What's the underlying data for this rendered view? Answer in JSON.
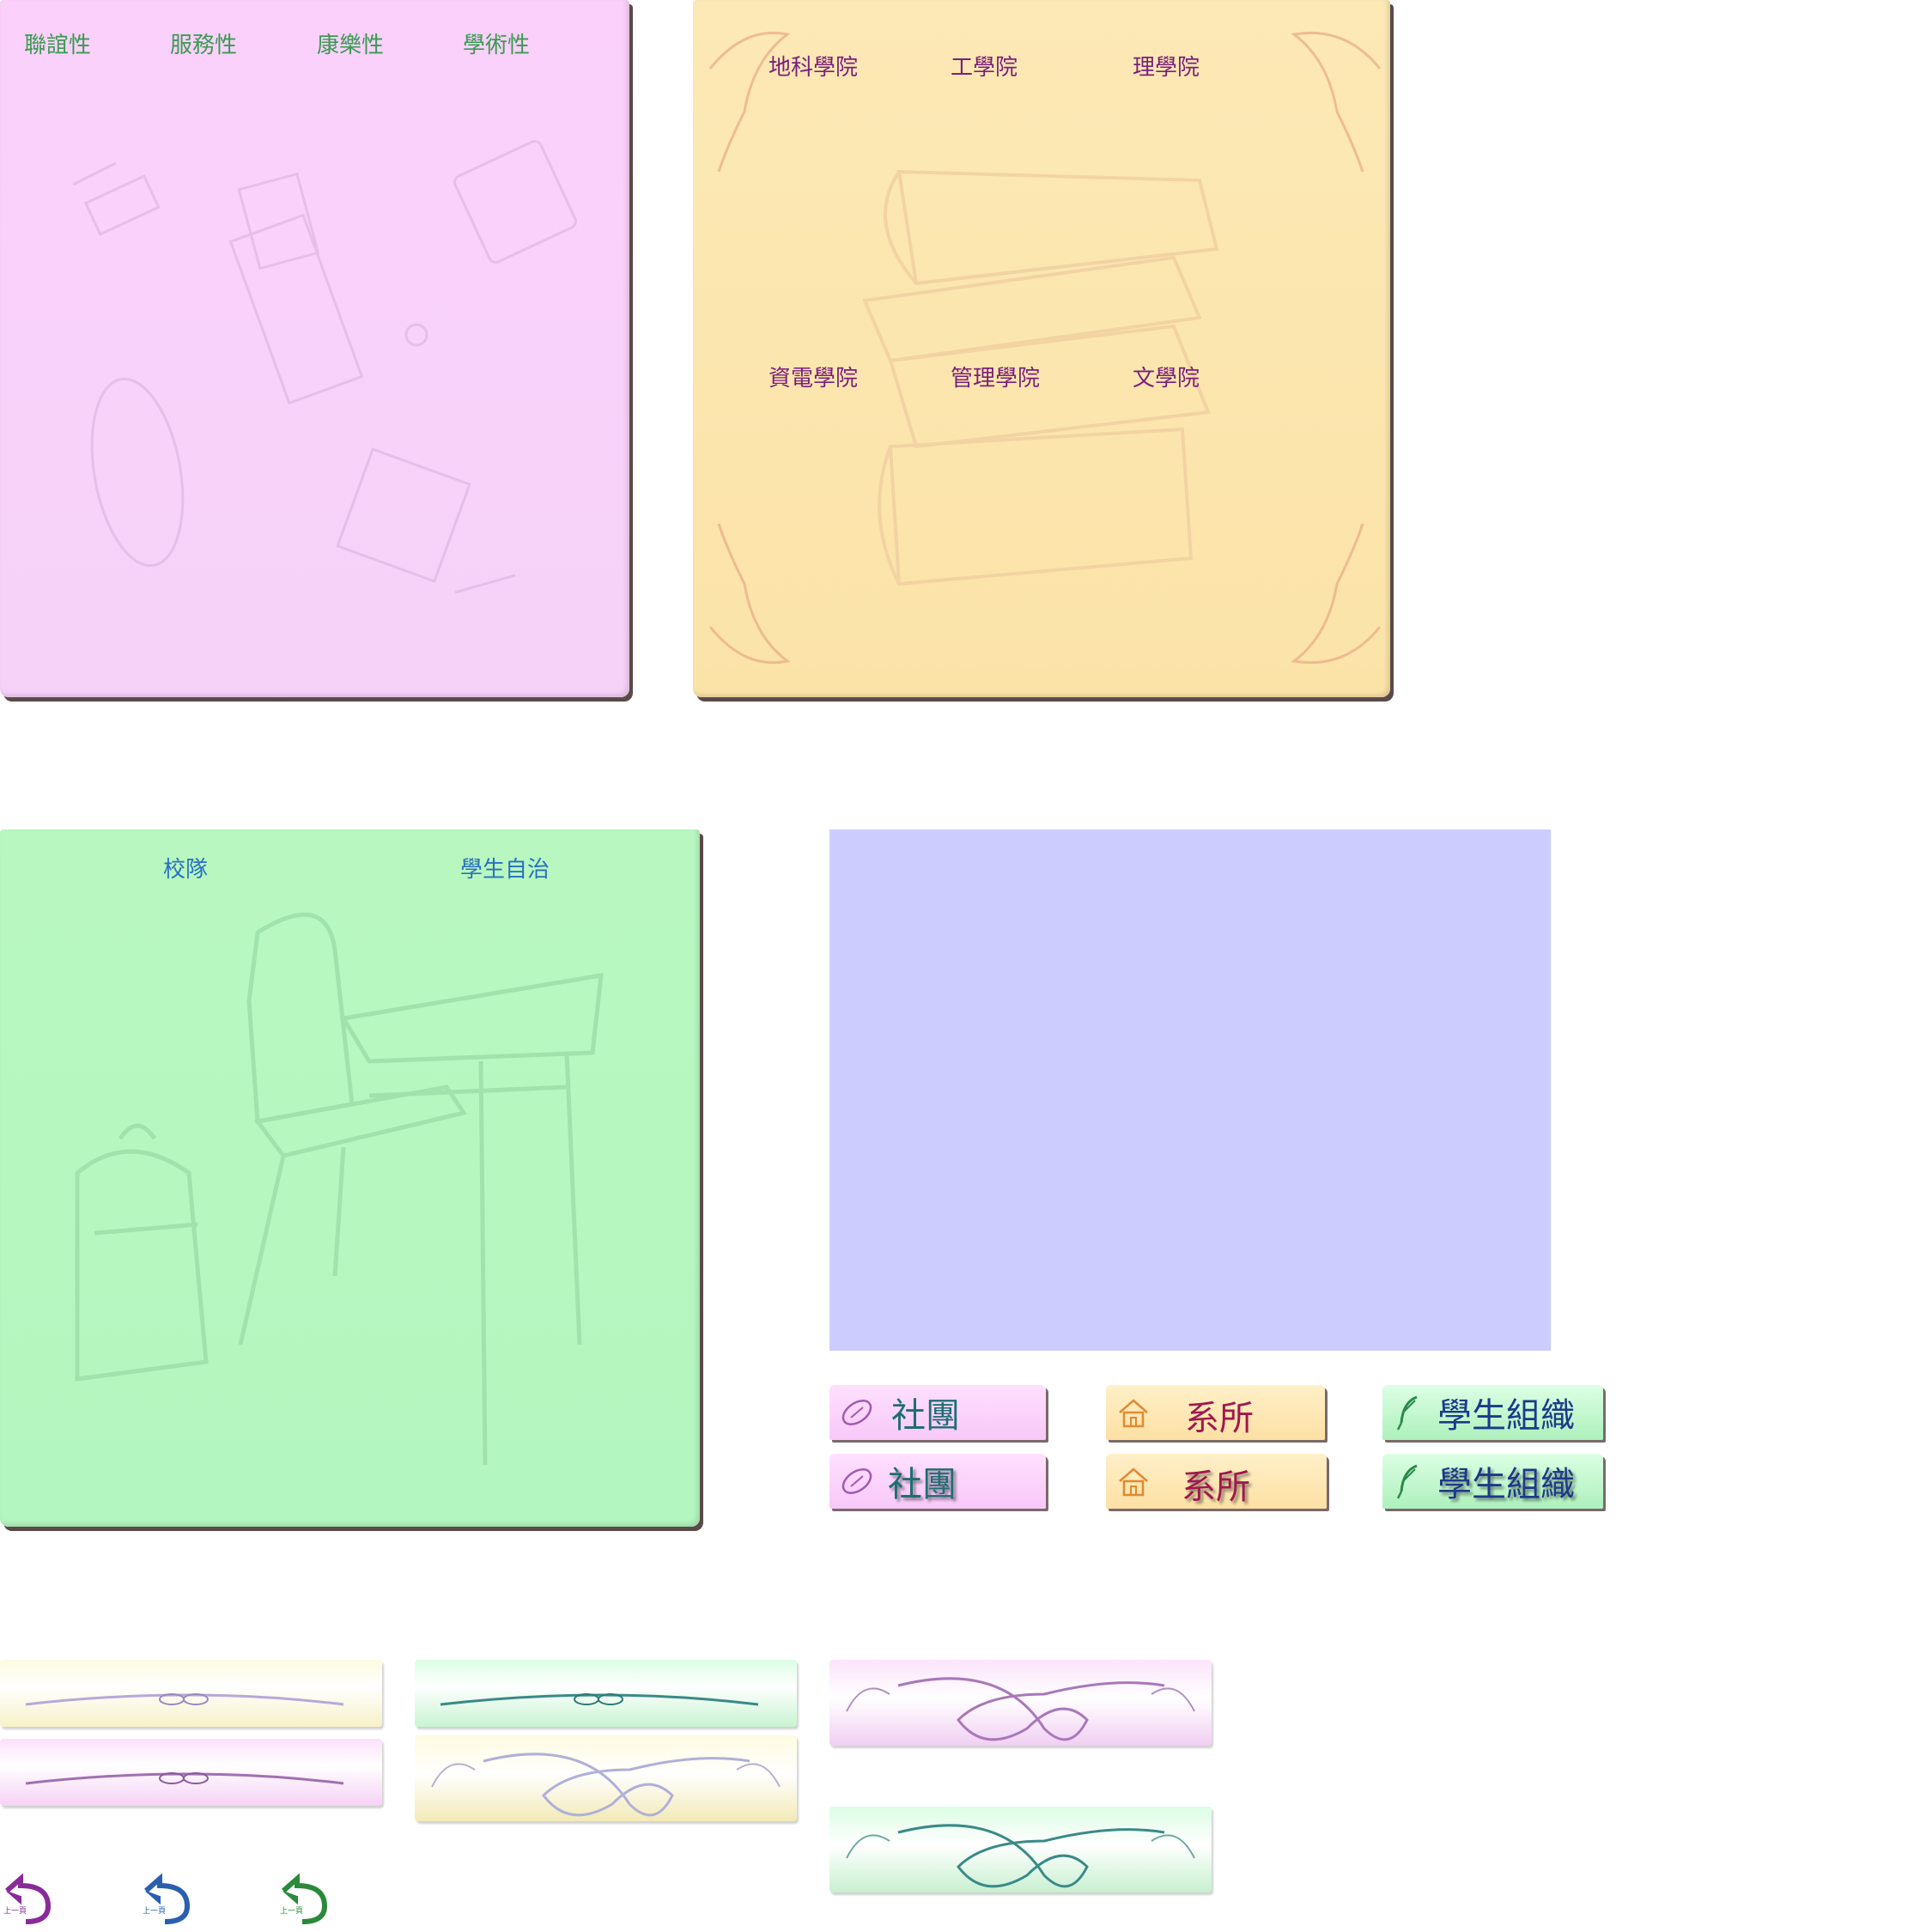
{
  "pink_panel": {
    "tabs": [
      "聯誼性",
      "服務性",
      "康樂性",
      "學術性"
    ],
    "color": "#fbd1fb"
  },
  "yellow_panel": {
    "tabs_top": [
      "地科學院",
      "工學院",
      "理學院"
    ],
    "tabs_bottom": [
      "資電學院",
      "管理學院",
      "文學院"
    ],
    "color": "#fde9b6"
  },
  "green_panel": {
    "tabs": [
      "校隊",
      "學生自治"
    ],
    "color": "#b8f8c0"
  },
  "lavender_panel": {
    "color": "#ccccfe"
  },
  "buttons": {
    "club_label": "社團",
    "dept_label": "系所",
    "org_label": "學生組織",
    "club_icon": "football-icon",
    "dept_icon": "schoolhouse-icon",
    "org_icon": "feather-quill-icon"
  },
  "back_buttons": {
    "label": "上一頁",
    "colors": [
      "#8a2a9a",
      "#2a5fb0",
      "#2a8a3a"
    ],
    "icon": "back-arrow-icon"
  }
}
